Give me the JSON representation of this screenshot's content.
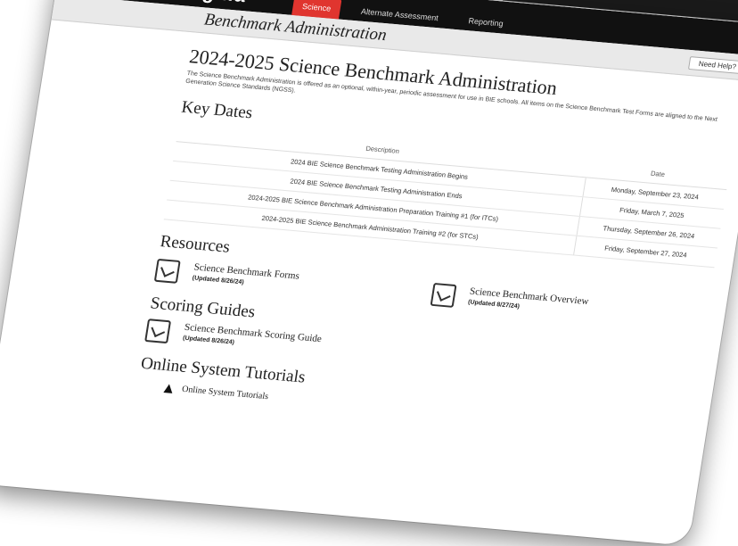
{
  "brand": {
    "logo": "ɔgnia"
  },
  "nav": {
    "items": [
      "Science",
      "Alternate Assessment",
      "Reporting"
    ],
    "active": "Science"
  },
  "titlebar": {
    "title": "Benchmark Administration",
    "help": "Need Help?"
  },
  "main": {
    "heading": "2024-2025 Science Benchmark Administration",
    "intro": "The Science Benchmark Administration is offered as an optional, within-year, periodic assessment for use in BIE schools. All items on the Science Benchmark Test Forms are aligned to the Next Generation Science Standards (NGSS)."
  },
  "key_dates": {
    "title": "Key Dates",
    "columns": [
      "Description",
      "Date"
    ],
    "rows": [
      {
        "description": "2024 BIE Science Benchmark Testing Administration Begins",
        "date": "Monday, September 23, 2024"
      },
      {
        "description": "2024 BIE Science Benchmark Testing Administration Ends",
        "date": "Friday, March 7, 2025"
      },
      {
        "description": "2024-2025 BIE Science Benchmark Administration Preparation Training #1 (for ITCs)",
        "date": "Thursday, September 26, 2024"
      },
      {
        "description": "2024-2025 BIE Science Benchmark Administration Training #2 (for STCs)",
        "date": "Friday, September 27, 2024"
      }
    ]
  },
  "resources": {
    "title": "Resources",
    "items": [
      {
        "name": "Science Benchmark Forms",
        "updated": "(Updated 8/26/24)"
      },
      {
        "name": "Science Benchmark Overview",
        "updated": "(Updated 8/27/24)"
      }
    ]
  },
  "scoring": {
    "title": "Scoring Guides",
    "items": [
      {
        "name": "Science Benchmark Scoring Guide",
        "updated": "(Updated 8/26/24)"
      }
    ]
  },
  "tutorials": {
    "title": "Online System Tutorials",
    "link": "Online System Tutorials"
  },
  "icons": {
    "pdf": "pdf-file-icon",
    "cursor": "mouse-cursor-icon"
  },
  "colors": {
    "active_nav": "#e0352f",
    "topbar": "#111111"
  }
}
